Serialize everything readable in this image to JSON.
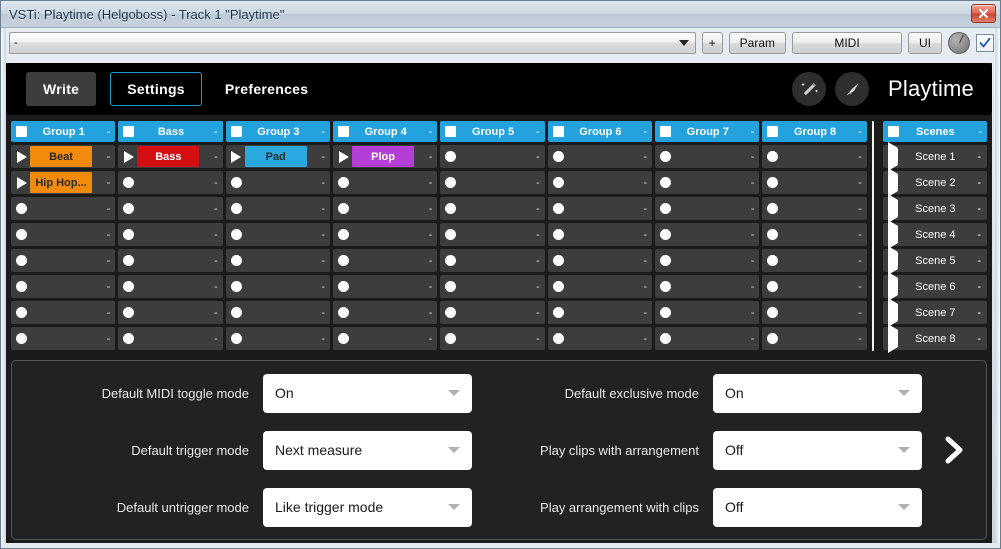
{
  "window": {
    "title": "VSTi: Playtime (Helgoboss) - Track 1 \"Playtime\"",
    "close_label": "x"
  },
  "host_toolbar": {
    "preset_value": "-",
    "add_label": "+",
    "param_label": "Param",
    "midi_label": "MIDI",
    "ui_label": "UI",
    "knob_name": "host-knob",
    "checkbox_checked": true
  },
  "plugin_header": {
    "write_label": "Write",
    "settings_label": "Settings",
    "preferences_label": "Preferences",
    "brand": "Playtime",
    "icons": [
      "magic-wand-icon",
      "broom-icon"
    ]
  },
  "matrix": {
    "scenes_header": "Scenes",
    "dash": "-",
    "groups": [
      {
        "label": "Group 1"
      },
      {
        "label": "Bass"
      },
      {
        "label": "Group 3"
      },
      {
        "label": "Group 4"
      },
      {
        "label": "Group 5"
      },
      {
        "label": "Group 6"
      },
      {
        "label": "Group 7"
      },
      {
        "label": "Group 8"
      }
    ],
    "scenes": [
      "Scene 1",
      "Scene 2",
      "Scene 3",
      "Scene 4",
      "Scene 5",
      "Scene 6",
      "Scene 7",
      "Scene 8"
    ],
    "clips": [
      [
        {
          "name": "Beat",
          "color": "#f28b0c",
          "text": "#2a2a2a"
        },
        {
          "name": "Bass",
          "color": "#d40f12",
          "text": "#ffffff"
        },
        {
          "name": "Pad",
          "color": "#2aa9e0",
          "text": "#2a2a2a"
        },
        {
          "name": "Plop",
          "color": "#b43fd6",
          "text": "#ffffff"
        },
        null,
        null,
        null,
        null
      ],
      [
        {
          "name": "Hip Hop...",
          "color": "#f28b0c",
          "text": "#2a2a2a"
        },
        null,
        null,
        null,
        null,
        null,
        null,
        null
      ],
      [
        null,
        null,
        null,
        null,
        null,
        null,
        null,
        null
      ],
      [
        null,
        null,
        null,
        null,
        null,
        null,
        null,
        null
      ],
      [
        null,
        null,
        null,
        null,
        null,
        null,
        null,
        null
      ],
      [
        null,
        null,
        null,
        null,
        null,
        null,
        null,
        null
      ],
      [
        null,
        null,
        null,
        null,
        null,
        null,
        null,
        null
      ],
      [
        null,
        null,
        null,
        null,
        null,
        null,
        null,
        null
      ]
    ]
  },
  "settings": {
    "left_column": [
      {
        "label": "Default MIDI toggle mode",
        "value": "On"
      },
      {
        "label": "Default trigger mode",
        "value": "Next measure"
      },
      {
        "label": "Default untrigger mode",
        "value": "Like trigger mode"
      }
    ],
    "right_column": [
      {
        "label": "Default exclusive mode",
        "value": "On"
      },
      {
        "label": "Play clips with arrangement",
        "value": "Off"
      },
      {
        "label": "Play arrangement with clips",
        "value": "Off"
      }
    ],
    "next_icon": "chevron-right-icon"
  },
  "colors": {
    "accent_blue": "#23a2dd",
    "panel_dark": "#222222",
    "cell_gray": "#3d3d3d"
  }
}
